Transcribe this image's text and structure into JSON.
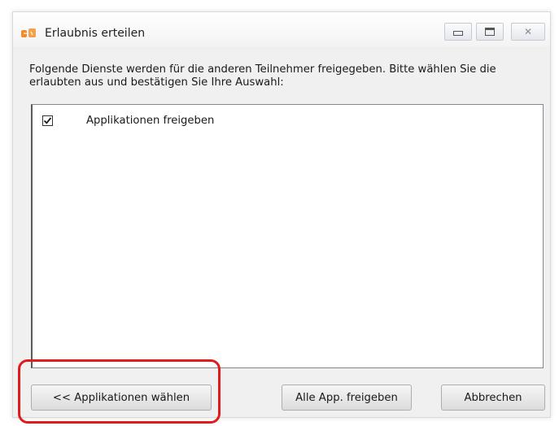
{
  "window": {
    "title": "Erlaubnis erteilen",
    "app_icon": "app-logo-icon",
    "controls": {
      "minimize_icon": "minimize-icon",
      "maximize_icon": "maximize-icon",
      "close_icon": "close-icon"
    }
  },
  "dialog": {
    "description": "Folgende Dienste werden für die anderen Teilnehmer freigegeben. Bitte wählen Sie die erlaubten aus und bestätigen Sie Ihre Auswahl:",
    "services": [
      {
        "label": "Applikationen freigeben",
        "checked": true
      }
    ]
  },
  "buttons": {
    "back_label": "<< Applikationen wählen",
    "allow_all_label": "Alle App. freigeben",
    "cancel_label": "Abbrechen"
  },
  "colors": {
    "highlight": "#e01b1b",
    "app_icon": "#f28c28"
  }
}
